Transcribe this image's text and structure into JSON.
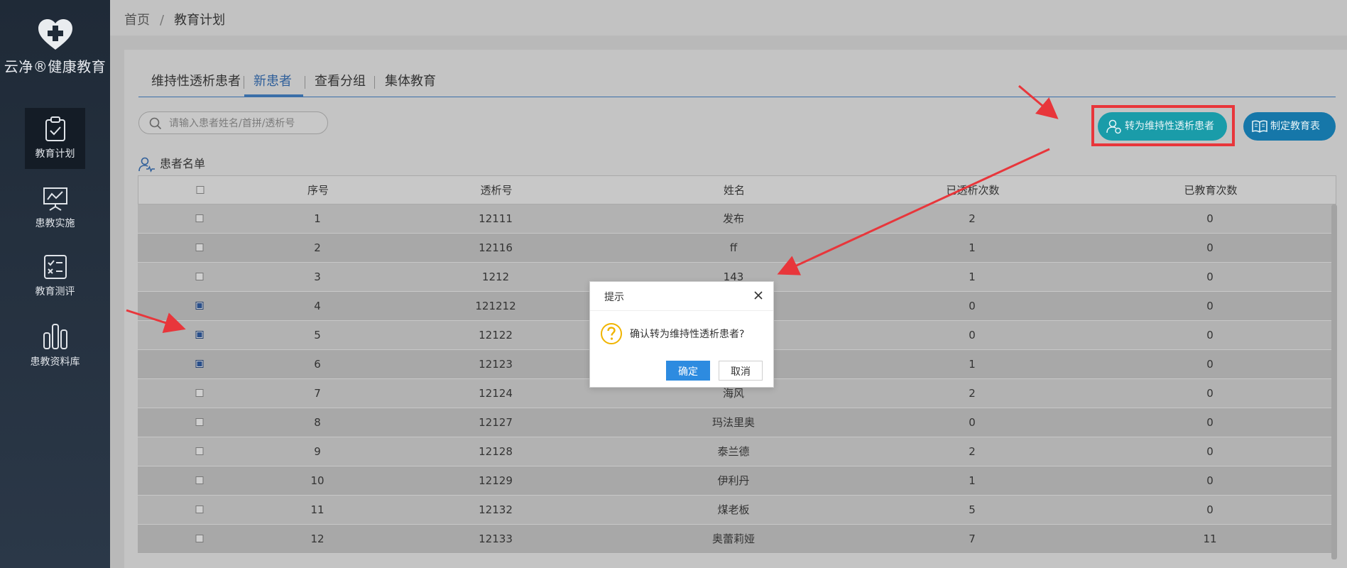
{
  "app": {
    "brand": "云净®健康教育",
    "logo_icon": "heart-cross-icon"
  },
  "sidebar": {
    "items": [
      {
        "label": "教育计划",
        "icon": "clipboard-check-icon",
        "active": true
      },
      {
        "label": "患教实施",
        "icon": "presentation-board-icon",
        "active": false
      },
      {
        "label": "教育测评",
        "icon": "checklist-icon",
        "active": false
      },
      {
        "label": "患教资料库",
        "icon": "books-icon",
        "active": false
      }
    ]
  },
  "breadcrumb": {
    "home": "首页",
    "separator": "/",
    "current": "教育计划"
  },
  "tabs": [
    {
      "label": "维持性透析患者",
      "active": false
    },
    {
      "label": "新患者",
      "active": true
    },
    {
      "label": "查看分组",
      "active": false
    },
    {
      "label": "集体教育",
      "active": false
    }
  ],
  "search": {
    "placeholder": "请输入患者姓名/首拼/透析号",
    "value": ""
  },
  "buttons": {
    "convert": "转为维持性透析患者",
    "plan": "制定教育表"
  },
  "list_title": "患者名单",
  "table": {
    "columns": [
      "序号",
      "透析号",
      "姓名",
      "已透析次数",
      "已教育次数"
    ],
    "rows": [
      {
        "checked": false,
        "cells": [
          "1",
          "12111",
          "发布",
          "2",
          "0"
        ]
      },
      {
        "checked": false,
        "cells": [
          "2",
          "12116",
          "ff",
          "1",
          "0"
        ]
      },
      {
        "checked": false,
        "cells": [
          "3",
          "1212",
          "143",
          "1",
          "0"
        ]
      },
      {
        "checked": true,
        "cells": [
          "4",
          "121212",
          "",
          "0",
          "0"
        ]
      },
      {
        "checked": true,
        "cells": [
          "5",
          "12122",
          "",
          "0",
          "0"
        ]
      },
      {
        "checked": true,
        "cells": [
          "6",
          "12123",
          "",
          "1",
          "0"
        ]
      },
      {
        "checked": false,
        "cells": [
          "7",
          "12124",
          "海风",
          "2",
          "0"
        ]
      },
      {
        "checked": false,
        "cells": [
          "8",
          "12127",
          "玛法里奥",
          "0",
          "0"
        ]
      },
      {
        "checked": false,
        "cells": [
          "9",
          "12128",
          "泰兰德",
          "2",
          "0"
        ]
      },
      {
        "checked": false,
        "cells": [
          "10",
          "12129",
          "伊利丹",
          "1",
          "0"
        ]
      },
      {
        "checked": false,
        "cells": [
          "11",
          "12132",
          "煤老板",
          "5",
          "0"
        ]
      },
      {
        "checked": false,
        "cells": [
          "12",
          "12133",
          "奥蕾莉娅",
          "7",
          "11"
        ]
      }
    ]
  },
  "dialog": {
    "title": "提示",
    "message": "确认转为维持性透析患者?",
    "ok": "确定",
    "cancel": "取消",
    "icon": "question-mark-icon"
  },
  "colors": {
    "sidebar_bg": "#1f2a37",
    "accent_teal": "#1a9ca9",
    "accent_blue": "#1677a9",
    "highlight_red": "#e8363b",
    "dialog_ok": "#2d8be0"
  }
}
